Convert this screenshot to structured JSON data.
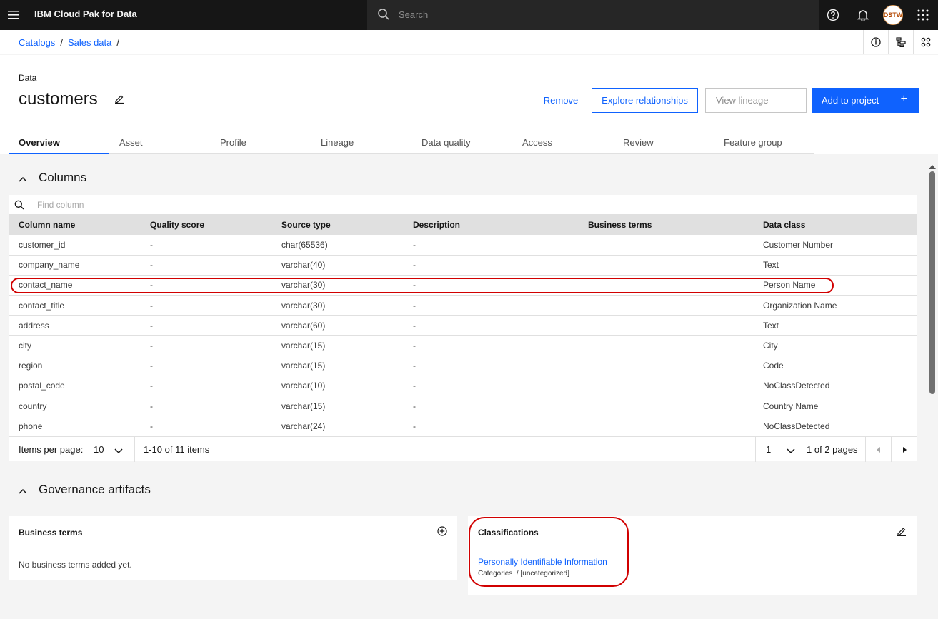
{
  "topbar": {
    "brand": "IBM Cloud Pak for Data",
    "search_placeholder": "Search",
    "avatar_initials": "DSTW"
  },
  "breadcrumb": {
    "items": [
      "Catalogs",
      "Sales data"
    ],
    "trailing_sep": "/"
  },
  "header": {
    "type_label": "Data",
    "asset_title": "customers",
    "buttons": {
      "remove": "Remove",
      "explore": "Explore relationships",
      "lineage": "View lineage",
      "add": "Add to project",
      "add_icon": "+"
    }
  },
  "tabs": [
    "Overview",
    "Asset",
    "Profile",
    "Lineage",
    "Data quality",
    "Access",
    "Review",
    "Feature group"
  ],
  "columns_section": {
    "title": "Columns",
    "find_placeholder": "Find column",
    "headers": [
      "Column name",
      "Quality score",
      "Source type",
      "Description",
      "Business terms",
      "Data class"
    ],
    "rows": [
      [
        "customer_id",
        "-",
        "char(65536)",
        "-",
        "",
        "Customer Number"
      ],
      [
        "company_name",
        "-",
        "varchar(40)",
        "-",
        "",
        "Text"
      ],
      [
        "contact_name",
        "-",
        "varchar(30)",
        "-",
        "",
        "Person Name"
      ],
      [
        "contact_title",
        "-",
        "varchar(30)",
        "-",
        "",
        "Organization Name"
      ],
      [
        "address",
        "-",
        "varchar(60)",
        "-",
        "",
        "Text"
      ],
      [
        "city",
        "-",
        "varchar(15)",
        "-",
        "",
        "City"
      ],
      [
        "region",
        "-",
        "varchar(15)",
        "-",
        "",
        "Code"
      ],
      [
        "postal_code",
        "-",
        "varchar(10)",
        "-",
        "",
        "NoClassDetected"
      ],
      [
        "country",
        "-",
        "varchar(15)",
        "-",
        "",
        "Country Name"
      ],
      [
        "phone",
        "-",
        "varchar(24)",
        "-",
        "",
        "NoClassDetected"
      ]
    ],
    "pagination": {
      "items_per_page_label": "Items per page:",
      "items_per_page": "10",
      "range": "1-10 of 11 items",
      "page": "1",
      "page_of": "1 of 2 pages"
    }
  },
  "governance_section": {
    "title": "Governance artifacts",
    "business_terms": {
      "title": "Business terms",
      "empty": "No business terms added yet."
    },
    "classifications": {
      "title": "Classifications",
      "item": "Personally Identifiable Information",
      "category": "Categories  / [uncategorized]"
    }
  },
  "colors": {
    "accent": "#0f62fe",
    "topbar": "#161616",
    "highlight": "#d10000"
  }
}
